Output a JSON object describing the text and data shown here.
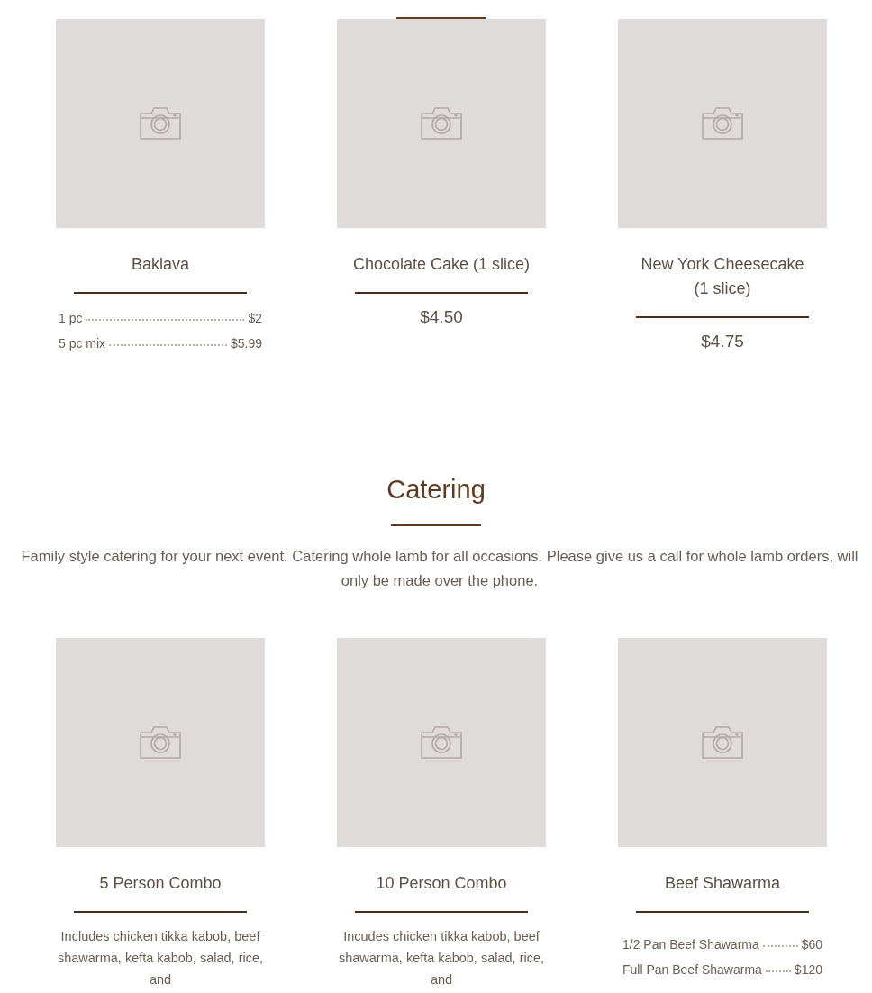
{
  "sections": [
    {
      "items": [
        {
          "name": "Baklava",
          "kind": "options",
          "options": [
            {
              "label": "1 pc",
              "price": "$2"
            },
            {
              "label": "5 pc mix",
              "price": "$5.99"
            }
          ]
        },
        {
          "name": "Chocolate Cake (1 slice)",
          "kind": "price",
          "price": "$4.50"
        },
        {
          "name": "New York Cheesecake (1 slice)",
          "kind": "price",
          "price": "$4.75"
        }
      ]
    },
    {
      "heading": "Catering",
      "description": "Family style catering for your next event. Catering whole lamb for all occasions. Please give us a call for whole lamb orders, will only be made over the phone.",
      "items": [
        {
          "name": "5 Person Combo",
          "kind": "description",
          "description": "Includes chicken tikka kabob, beef shawarma, kefta kabob, salad, rice, and"
        },
        {
          "name": "10 Person Combo",
          "kind": "description",
          "description": "Incudes chicken tikka kabob, beef shawarma, kefta kabob, salad, rice, and"
        },
        {
          "name": "Beef Shawarma",
          "kind": "options",
          "options": [
            {
              "label": "1/2 Pan Beef Shawarma",
              "price": "$60"
            },
            {
              "label": "Full Pan Beef Shawarma",
              "price": "$120"
            }
          ]
        }
      ]
    }
  ]
}
